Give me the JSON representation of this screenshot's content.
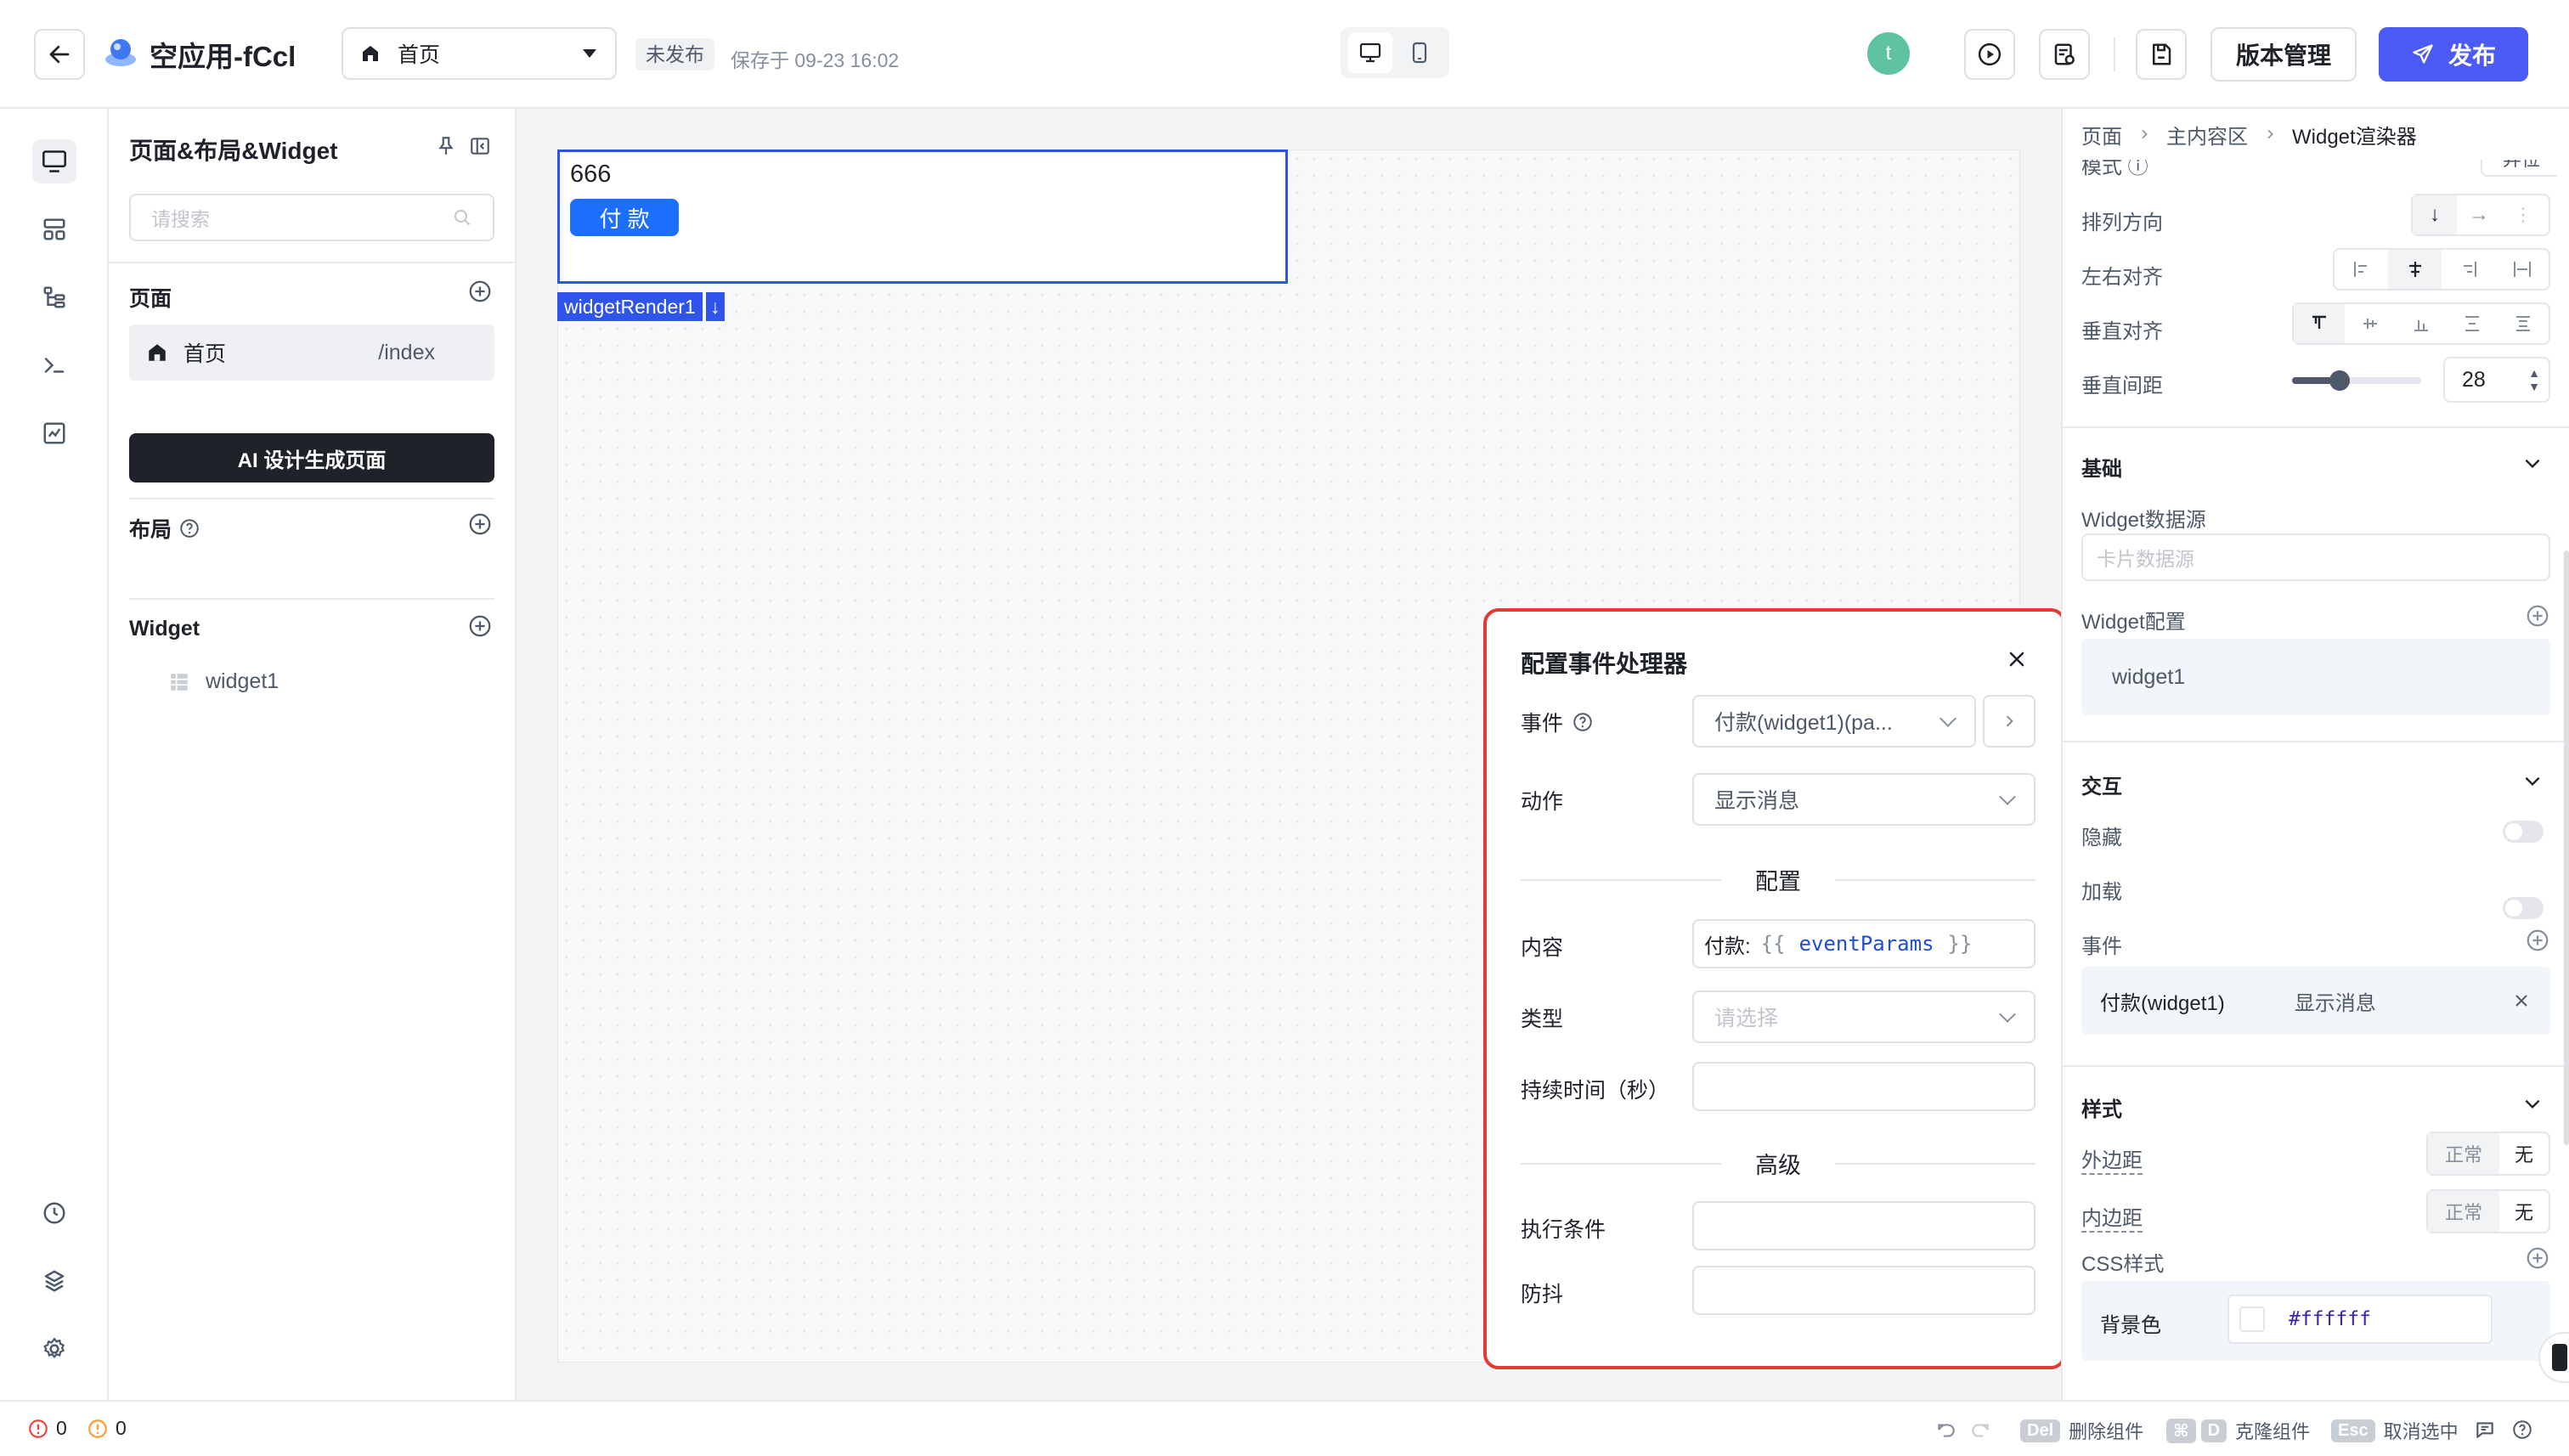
{
  "header": {
    "app_title": "空应用-fCcl",
    "page_select": "首页",
    "status_badge": "未发布",
    "saved_text": "保存于 09-23 16:02",
    "avatar_letter": "t",
    "version_btn": "版本管理",
    "publish_btn": "发布"
  },
  "left_panel": {
    "title": "页面&布局&Widget",
    "search_placeholder": "请搜索",
    "pages_title": "页面",
    "pages": [
      {
        "name": "首页",
        "path": "/index"
      }
    ],
    "ai_button": "AI 设计生成页面",
    "layout_title": "布局",
    "widget_title": "Widget",
    "widgets": [
      "widget1"
    ]
  },
  "canvas": {
    "widget_text": "666",
    "pay_button": "付 款",
    "widget_tag": "widgetRender1",
    "tag_arrow": "↓"
  },
  "right_panel": {
    "breadcrumb": [
      "页面",
      "主内容区",
      "Widget渲染器"
    ],
    "cut_label": "模式 ⓘ",
    "cut_btn": "弃位",
    "arrangement_label": "排列方向",
    "halign_label": "左右对齐",
    "valign_label": "垂直对齐",
    "vspacing_label": "垂直间距",
    "vspacing_value": "28",
    "basic_title": "基础",
    "widget_datasource_label": "Widget数据源",
    "widget_datasource_placeholder": "卡片数据源",
    "widget_config_label": "Widget配置",
    "widget_config_value": "widget1",
    "interaction_title": "交互",
    "hidden_label": "隐藏",
    "loading_label": "加载",
    "events_label": "事件",
    "event_item": {
      "event": "付款(widget1)",
      "action": "显示消息"
    },
    "style_title": "样式",
    "margin_label": "外边距",
    "padding_label": "内边距",
    "seg_normal": "正常",
    "seg_none": "无",
    "css_label": "CSS样式",
    "bg_label": "背景色",
    "bg_value": "#ffffff"
  },
  "dialog": {
    "title": "配置事件处理器",
    "event_label": "事件",
    "event_value": "付款(widget1)(pa...",
    "action_label": "动作",
    "action_value": "显示消息",
    "config_section": "配置",
    "content_label": "内容",
    "content_prefix": "付款:",
    "content_open": "{{",
    "content_expr": "eventParams",
    "content_close": "}}",
    "type_label": "类型",
    "type_placeholder": "请选择",
    "duration_label": "持续时间（秒）",
    "advanced_section": "高级",
    "condition_label": "执行条件",
    "debounce_label": "防抖"
  },
  "footer": {
    "error_count": "0",
    "warning_count": "0",
    "del_key": "Del",
    "del_text": "删除组件",
    "cmd_key": "⌘",
    "d_key": "D",
    "clone_text": "克隆组件",
    "esc_key": "Esc",
    "deselect_text": "取消选中"
  },
  "colors": {
    "primary": "#4d5bf6",
    "blue": "#1d6fff",
    "selection": "#2f54eb",
    "dialog_border": "#e53935",
    "avatar": "#5fc3a3",
    "dark_button": "#1f2329"
  }
}
